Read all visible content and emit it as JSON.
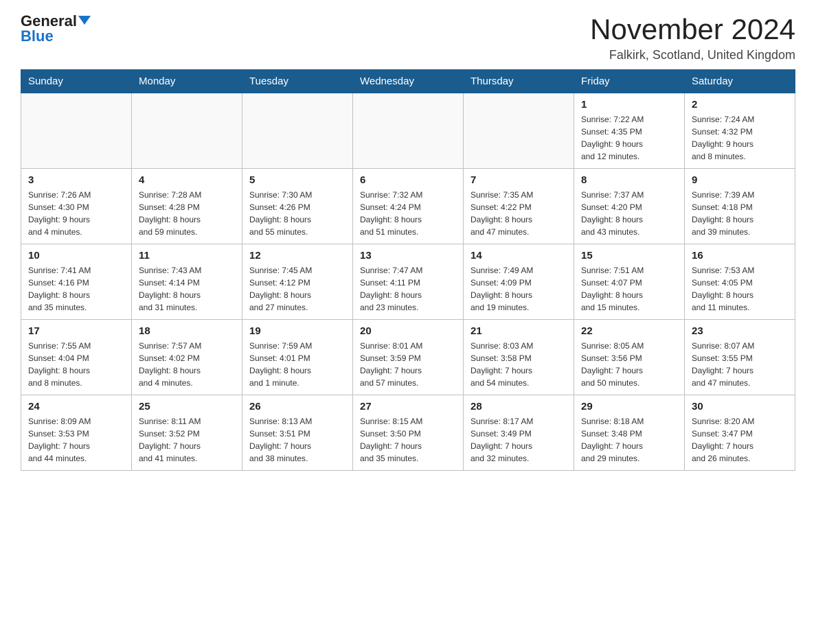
{
  "logo": {
    "general": "General",
    "blue": "Blue"
  },
  "title": "November 2024",
  "location": "Falkirk, Scotland, United Kingdom",
  "days_of_week": [
    "Sunday",
    "Monday",
    "Tuesday",
    "Wednesday",
    "Thursday",
    "Friday",
    "Saturday"
  ],
  "weeks": [
    [
      {
        "day": "",
        "info": ""
      },
      {
        "day": "",
        "info": ""
      },
      {
        "day": "",
        "info": ""
      },
      {
        "day": "",
        "info": ""
      },
      {
        "day": "",
        "info": ""
      },
      {
        "day": "1",
        "info": "Sunrise: 7:22 AM\nSunset: 4:35 PM\nDaylight: 9 hours\nand 12 minutes."
      },
      {
        "day": "2",
        "info": "Sunrise: 7:24 AM\nSunset: 4:32 PM\nDaylight: 9 hours\nand 8 minutes."
      }
    ],
    [
      {
        "day": "3",
        "info": "Sunrise: 7:26 AM\nSunset: 4:30 PM\nDaylight: 9 hours\nand 4 minutes."
      },
      {
        "day": "4",
        "info": "Sunrise: 7:28 AM\nSunset: 4:28 PM\nDaylight: 8 hours\nand 59 minutes."
      },
      {
        "day": "5",
        "info": "Sunrise: 7:30 AM\nSunset: 4:26 PM\nDaylight: 8 hours\nand 55 minutes."
      },
      {
        "day": "6",
        "info": "Sunrise: 7:32 AM\nSunset: 4:24 PM\nDaylight: 8 hours\nand 51 minutes."
      },
      {
        "day": "7",
        "info": "Sunrise: 7:35 AM\nSunset: 4:22 PM\nDaylight: 8 hours\nand 47 minutes."
      },
      {
        "day": "8",
        "info": "Sunrise: 7:37 AM\nSunset: 4:20 PM\nDaylight: 8 hours\nand 43 minutes."
      },
      {
        "day": "9",
        "info": "Sunrise: 7:39 AM\nSunset: 4:18 PM\nDaylight: 8 hours\nand 39 minutes."
      }
    ],
    [
      {
        "day": "10",
        "info": "Sunrise: 7:41 AM\nSunset: 4:16 PM\nDaylight: 8 hours\nand 35 minutes."
      },
      {
        "day": "11",
        "info": "Sunrise: 7:43 AM\nSunset: 4:14 PM\nDaylight: 8 hours\nand 31 minutes."
      },
      {
        "day": "12",
        "info": "Sunrise: 7:45 AM\nSunset: 4:12 PM\nDaylight: 8 hours\nand 27 minutes."
      },
      {
        "day": "13",
        "info": "Sunrise: 7:47 AM\nSunset: 4:11 PM\nDaylight: 8 hours\nand 23 minutes."
      },
      {
        "day": "14",
        "info": "Sunrise: 7:49 AM\nSunset: 4:09 PM\nDaylight: 8 hours\nand 19 minutes."
      },
      {
        "day": "15",
        "info": "Sunrise: 7:51 AM\nSunset: 4:07 PM\nDaylight: 8 hours\nand 15 minutes."
      },
      {
        "day": "16",
        "info": "Sunrise: 7:53 AM\nSunset: 4:05 PM\nDaylight: 8 hours\nand 11 minutes."
      }
    ],
    [
      {
        "day": "17",
        "info": "Sunrise: 7:55 AM\nSunset: 4:04 PM\nDaylight: 8 hours\nand 8 minutes."
      },
      {
        "day": "18",
        "info": "Sunrise: 7:57 AM\nSunset: 4:02 PM\nDaylight: 8 hours\nand 4 minutes."
      },
      {
        "day": "19",
        "info": "Sunrise: 7:59 AM\nSunset: 4:01 PM\nDaylight: 8 hours\nand 1 minute."
      },
      {
        "day": "20",
        "info": "Sunrise: 8:01 AM\nSunset: 3:59 PM\nDaylight: 7 hours\nand 57 minutes."
      },
      {
        "day": "21",
        "info": "Sunrise: 8:03 AM\nSunset: 3:58 PM\nDaylight: 7 hours\nand 54 minutes."
      },
      {
        "day": "22",
        "info": "Sunrise: 8:05 AM\nSunset: 3:56 PM\nDaylight: 7 hours\nand 50 minutes."
      },
      {
        "day": "23",
        "info": "Sunrise: 8:07 AM\nSunset: 3:55 PM\nDaylight: 7 hours\nand 47 minutes."
      }
    ],
    [
      {
        "day": "24",
        "info": "Sunrise: 8:09 AM\nSunset: 3:53 PM\nDaylight: 7 hours\nand 44 minutes."
      },
      {
        "day": "25",
        "info": "Sunrise: 8:11 AM\nSunset: 3:52 PM\nDaylight: 7 hours\nand 41 minutes."
      },
      {
        "day": "26",
        "info": "Sunrise: 8:13 AM\nSunset: 3:51 PM\nDaylight: 7 hours\nand 38 minutes."
      },
      {
        "day": "27",
        "info": "Sunrise: 8:15 AM\nSunset: 3:50 PM\nDaylight: 7 hours\nand 35 minutes."
      },
      {
        "day": "28",
        "info": "Sunrise: 8:17 AM\nSunset: 3:49 PM\nDaylight: 7 hours\nand 32 minutes."
      },
      {
        "day": "29",
        "info": "Sunrise: 8:18 AM\nSunset: 3:48 PM\nDaylight: 7 hours\nand 29 minutes."
      },
      {
        "day": "30",
        "info": "Sunrise: 8:20 AM\nSunset: 3:47 PM\nDaylight: 7 hours\nand 26 minutes."
      }
    ]
  ]
}
